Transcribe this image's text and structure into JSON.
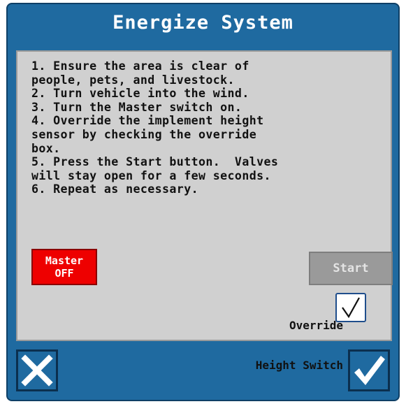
{
  "dialog": {
    "title": "Energize System"
  },
  "instructions": [
    "1. Ensure the area is clear of",
    "people, pets, and livestock.",
    "2. Turn vehicle into the wind.",
    "3. Turn the Master switch on.",
    "4. Override the implement height",
    "sensor by checking the override",
    "box.",
    "5. Press the Start button.  Valves",
    "will stay open for a few seconds.",
    "6. Repeat as necessary."
  ],
  "master_button": {
    "line1": "Master",
    "line2": "OFF",
    "color": "#ee0000"
  },
  "start_button": {
    "label": "Start",
    "enabled": false
  },
  "override": {
    "line1": "Override",
    "line2": "Height Switch",
    "checked": true
  },
  "footer": {
    "cancel_icon": "close-icon",
    "confirm_icon": "checkmark-icon"
  },
  "colors": {
    "dialog_blue": "#1f6aa0",
    "panel_gray": "#d0d0d0",
    "master_red": "#ee0000"
  }
}
